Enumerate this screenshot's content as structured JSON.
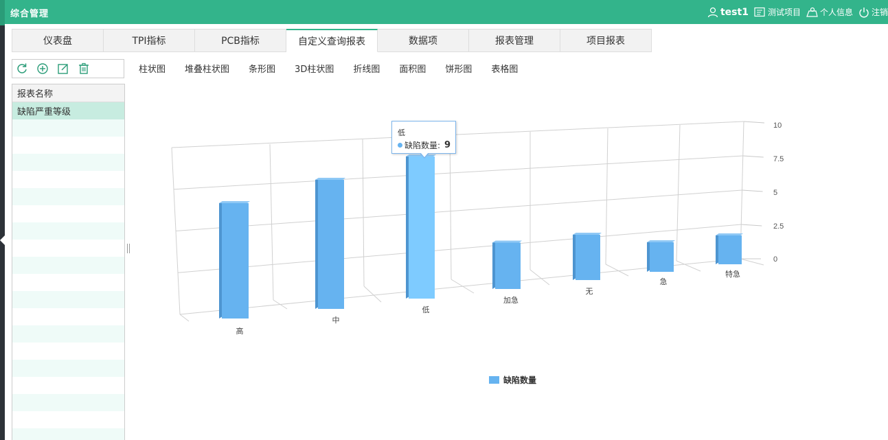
{
  "header": {
    "app_title": "综合管理",
    "user": "test1",
    "test_project": "测试项目",
    "personal_info": "个人信息",
    "logout": "注销",
    "brand_color": "#33b48b"
  },
  "tabs": [
    "仪表盘",
    "TPI指标",
    "PCB指标",
    "自定义查询报表",
    "数据项",
    "报表管理",
    "项目报表"
  ],
  "active_tab": "自定义查询报表",
  "toolbar": {
    "icons": [
      "refresh-icon",
      "add-icon",
      "edit-icon",
      "delete-icon"
    ]
  },
  "report_list": {
    "header": "报表名称",
    "items": [
      "缺陷严重等级"
    ]
  },
  "chart_types": [
    "柱状图",
    "堆叠柱状图",
    "条形图",
    "3D柱状图",
    "折线图",
    "面积图",
    "饼形图",
    "表格图"
  ],
  "tooltip": {
    "category": "低",
    "series": "缺陷数量:",
    "value": "9"
  },
  "chart_data": {
    "type": "bar",
    "variant": "3d-column",
    "categories": [
      "高",
      "中",
      "低",
      "加急",
      "无",
      "急",
      "特急"
    ],
    "series": [
      {
        "name": "缺陷数量",
        "values": [
          7,
          8,
          9,
          3,
          3,
          2,
          2
        ],
        "color": "#66b3f0"
      }
    ],
    "yticks": [
      "0",
      "2.5",
      "5",
      "7.5",
      "10"
    ],
    "ylim": [
      0,
      10
    ],
    "grid": true,
    "legend_position": "bottom-center",
    "hover_color": "#7ecbff"
  }
}
